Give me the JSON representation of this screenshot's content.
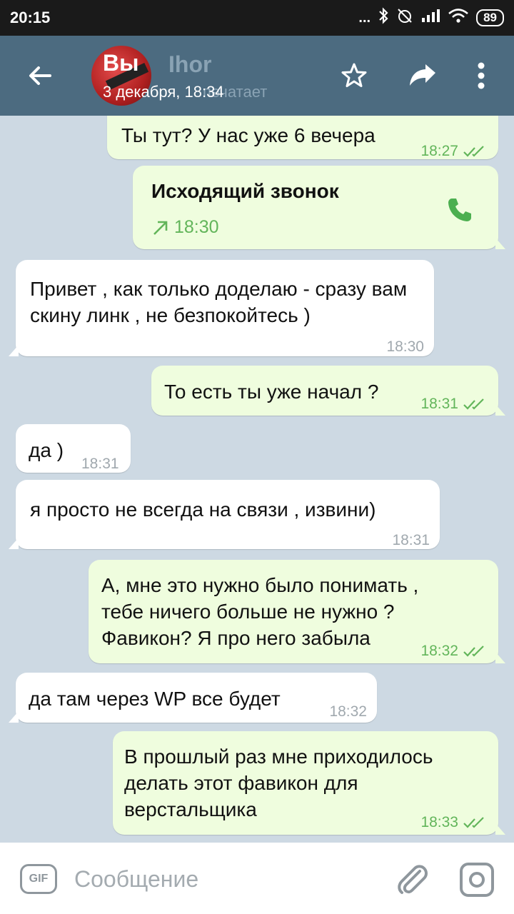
{
  "status_bar": {
    "time": "20:15",
    "signal_dots": "...",
    "battery": "89"
  },
  "header": {
    "avatar_text": "Вы",
    "name": "Ihor",
    "date": "3 декабря, 18:34",
    "status": "печатает"
  },
  "messages": [
    {
      "direction": "out",
      "text": "Ты тут? У нас уже 6 вечера",
      "time": "18:27",
      "read": true
    },
    {
      "direction": "out",
      "type": "call",
      "title": "Исходящий звонок",
      "time": "18:30"
    },
    {
      "direction": "in",
      "text": "Привет , как только доделаю - сразу вам скину линк , не безпокойтесь )",
      "time": "18:30"
    },
    {
      "direction": "out",
      "text": "То есть ты уже начал ?",
      "time": "18:31",
      "read": true
    },
    {
      "direction": "in",
      "text": "да )",
      "time": "18:31"
    },
    {
      "direction": "in",
      "text": "я просто не всегда на связи , извини)",
      "time": "18:31"
    },
    {
      "direction": "out",
      "text": "А, мне это нужно было понимать , тебе ничего больше не нужно ? Фавикон? Я про него забыла",
      "time": "18:32",
      "read": true
    },
    {
      "direction": "in",
      "text": "да там через WP все будет",
      "time": "18:32"
    },
    {
      "direction": "out",
      "text": "В прошлый раз мне приходилось делать этот фавикон для верстальщика",
      "time": "18:33",
      "read": true
    }
  ],
  "composer": {
    "gif_label": "GIF",
    "placeholder": "Сообщение"
  },
  "colors": {
    "header_bg": "#4c6b80",
    "outgoing_bubble": "#effdde",
    "incoming_bubble": "#ffffff",
    "read_check": "#62b55a",
    "chat_bg": "#cdd9e3"
  }
}
